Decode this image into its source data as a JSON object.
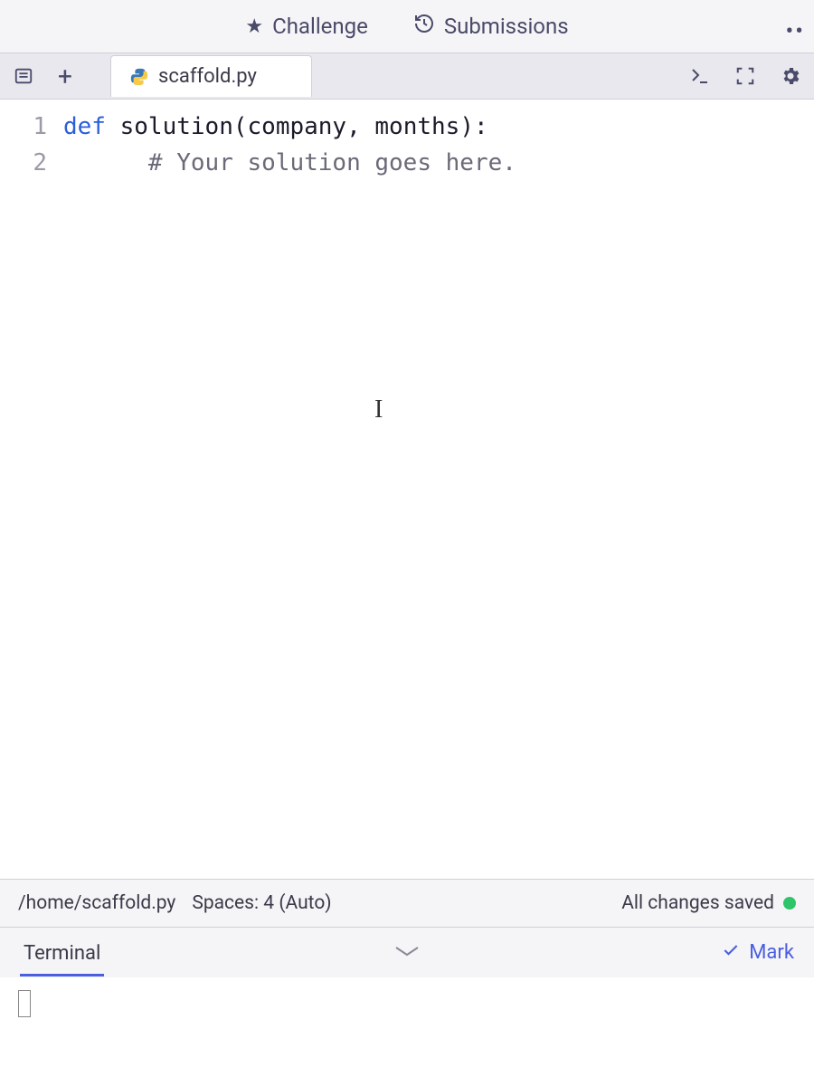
{
  "tabs": {
    "challenge": "Challenge",
    "submissions": "Submissions"
  },
  "file": {
    "name": "scaffold.py"
  },
  "code": {
    "lines": [
      {
        "num": "1",
        "kw": "def ",
        "fn": "solution",
        "params": "(company, months)",
        "tail": ":"
      },
      {
        "num": "2",
        "indent": "      ",
        "comment": "# Your solution goes here."
      }
    ]
  },
  "status": {
    "path": "/home/scaffold.py",
    "spaces": "Spaces: 4 (Auto)",
    "saved": "All changes saved"
  },
  "terminal": {
    "label": "Terminal",
    "mark": "Mark"
  }
}
